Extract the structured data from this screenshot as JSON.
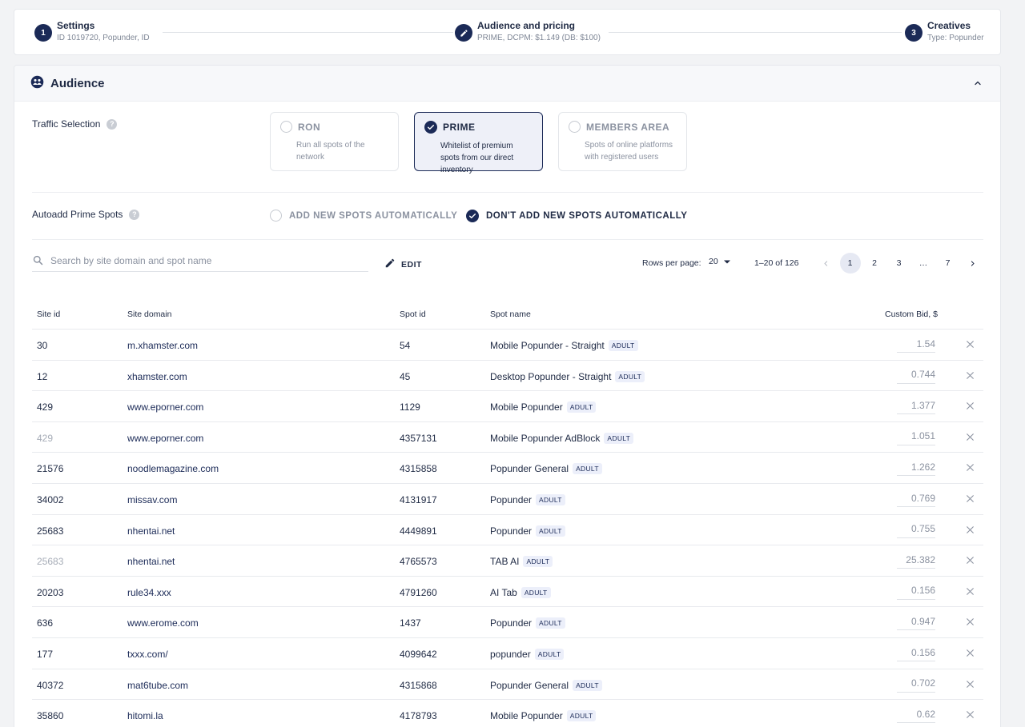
{
  "stepper": {
    "steps": [
      {
        "number": "1",
        "title": "Settings",
        "subtitle": "ID 1019720, Popunder, ID"
      },
      {
        "number": "",
        "title": "Audience and pricing",
        "subtitle": "PRIME, DCPM: $1.149 (DB: $100)"
      },
      {
        "number": "3",
        "title": "Creatives",
        "subtitle": "Type: Popunder"
      }
    ]
  },
  "audience": {
    "title": "Audience",
    "traffic_label": "Traffic Selection",
    "traffic_options": [
      {
        "title": "RON",
        "desc": "Run all spots of the network",
        "selected": false
      },
      {
        "title": "PRIME",
        "desc": "Whitelist of premium spots from our direct inventory",
        "selected": true
      },
      {
        "title": "MEMBERS AREA",
        "desc": "Spots of online platforms with registered users",
        "selected": false
      }
    ],
    "autoadd_label": "Autoadd Prime Spots",
    "autoadd_options": [
      {
        "label": "ADD NEW SPOTS AUTOMATICALLY",
        "selected": false
      },
      {
        "label": "DON'T ADD NEW SPOTS AUTOMATICALLY",
        "selected": true
      }
    ],
    "search_placeholder": "Search by site domain and spot name",
    "edit_label": "EDIT",
    "rows_per_page_label": "Rows per page:",
    "rows_per_page_value": "20",
    "range_label": "1–20 of 126",
    "pages": [
      "1",
      "2",
      "3",
      "…",
      "7"
    ],
    "current_page": "1",
    "columns": [
      "Site id",
      "Site domain",
      "Spot id",
      "Spot name",
      "Custom Bid, $"
    ],
    "badge_label": "ADULT",
    "rows": [
      {
        "site_id": "30",
        "domain": "m.xhamster.com",
        "spot_id": "54",
        "spot_name": "Mobile Popunder - Straight",
        "bid": "1.54",
        "muted": false
      },
      {
        "site_id": "12",
        "domain": "xhamster.com",
        "spot_id": "45",
        "spot_name": "Desktop Popunder - Straight",
        "bid": "0.744",
        "muted": false
      },
      {
        "site_id": "429",
        "domain": "www.eporner.com",
        "spot_id": "1129",
        "spot_name": "Mobile Popunder",
        "bid": "1.377",
        "muted": false
      },
      {
        "site_id": "429",
        "domain": "www.eporner.com",
        "spot_id": "4357131",
        "spot_name": "Mobile Popunder AdBlock",
        "bid": "1.051",
        "muted": true
      },
      {
        "site_id": "21576",
        "domain": "noodlemagazine.com",
        "spot_id": "4315858",
        "spot_name": "Popunder General",
        "bid": "1.262",
        "muted": false
      },
      {
        "site_id": "34002",
        "domain": "missav.com",
        "spot_id": "4131917",
        "spot_name": "Popunder",
        "bid": "0.769",
        "muted": false
      },
      {
        "site_id": "25683",
        "domain": "nhentai.net",
        "spot_id": "4449891",
        "spot_name": "Popunder",
        "bid": "0.755",
        "muted": false
      },
      {
        "site_id": "25683",
        "domain": "nhentai.net",
        "spot_id": "4765573",
        "spot_name": "TAB AI",
        "bid": "25.382",
        "muted": true
      },
      {
        "site_id": "20203",
        "domain": "rule34.xxx",
        "spot_id": "4791260",
        "spot_name": "AI Tab",
        "bid": "0.156",
        "muted": false
      },
      {
        "site_id": "636",
        "domain": "www.erome.com",
        "spot_id": "1437",
        "spot_name": "Popunder",
        "bid": "0.947",
        "muted": false
      },
      {
        "site_id": "177",
        "domain": "txxx.com/",
        "spot_id": "4099642",
        "spot_name": "popunder",
        "bid": "0.156",
        "muted": false
      },
      {
        "site_id": "40372",
        "domain": "mat6tube.com",
        "spot_id": "4315868",
        "spot_name": "Popunder General",
        "bid": "0.702",
        "muted": false
      },
      {
        "site_id": "35860",
        "domain": "hitomi.la",
        "spot_id": "4178793",
        "spot_name": "Mobile Popunder",
        "bid": "0.62",
        "muted": false
      }
    ]
  },
  "colors": {
    "primary": "#1b2a57",
    "muted_text": "#8b92a0",
    "selected_card_bg": "#eef0f8",
    "badge_bg": "#eceffa"
  }
}
